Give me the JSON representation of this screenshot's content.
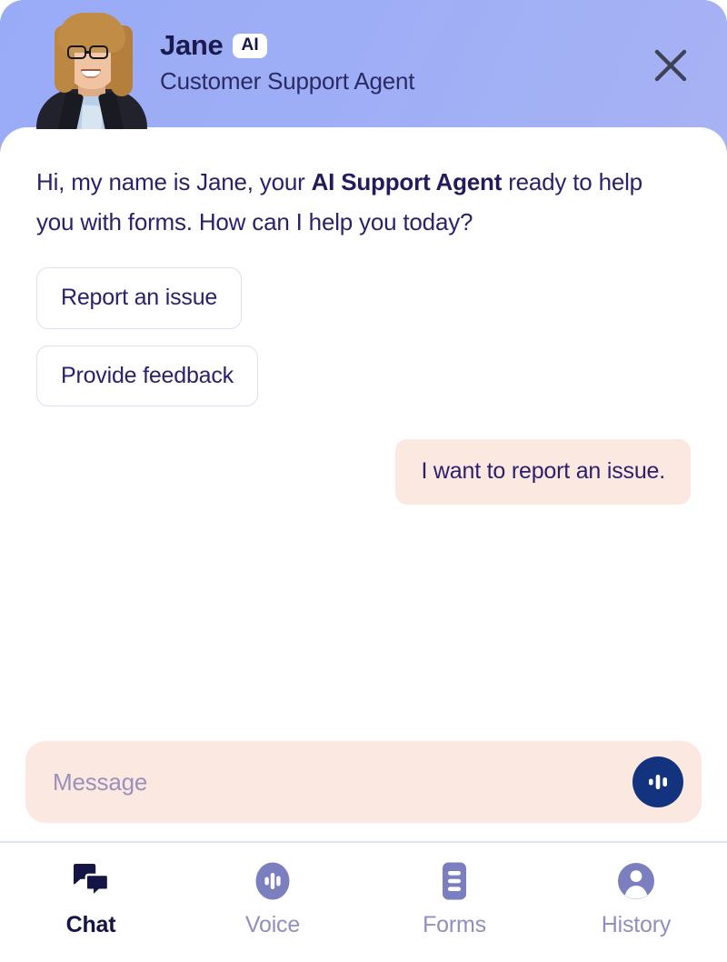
{
  "header": {
    "agent_name": "Jane",
    "ai_badge": "AI",
    "agent_role": "Customer Support Agent",
    "avatar_name": "agent-avatar-photo",
    "close_label": "close-icon",
    "background_color": "#9eaef6",
    "name_color": "#1b1b4d",
    "role_color": "#2b2b63",
    "badge_bg": "#ffffff"
  },
  "conversation": {
    "bot_message": {
      "before": "Hi, my name is Jane, your ",
      "bold": "AI Support Agent",
      "after": " ready to help you with forms. How can I help you today?"
    },
    "suggestions": [
      {
        "label": "Report an issue"
      },
      {
        "label": "Provide feedback"
      }
    ],
    "user_message": "I want to report an issue.",
    "user_bubble_color": "#fbe8e1",
    "text_color": "#2c1f6b"
  },
  "composer": {
    "placeholder": "Message",
    "value": "",
    "background_color": "#fbe8e1",
    "voice_button_color": "#14337f",
    "voice_icon": "waveform-icon"
  },
  "bottom_nav": {
    "active_index": 0,
    "active_color": "#151545",
    "inactive_color": "#8f8fc0",
    "icon_color": "#7b7fc0",
    "items": [
      {
        "label": "Chat",
        "icon": "chat-bubbles-icon"
      },
      {
        "label": "Voice",
        "icon": "waveform-circle-icon"
      },
      {
        "label": "Forms",
        "icon": "document-lines-icon"
      },
      {
        "label": "History",
        "icon": "person-circle-icon"
      }
    ]
  }
}
